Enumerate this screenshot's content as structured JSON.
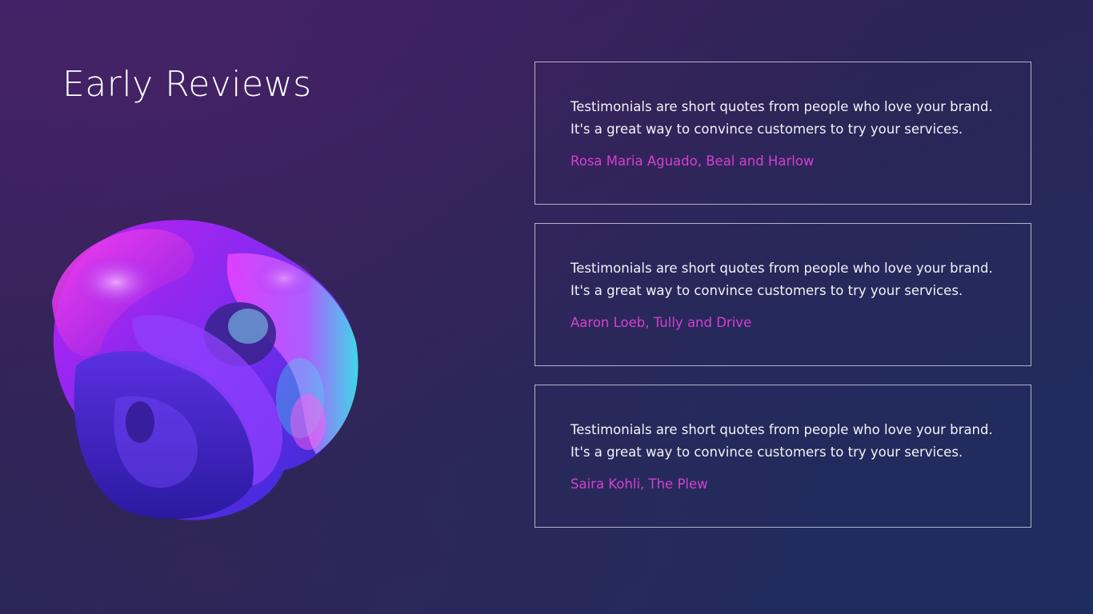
{
  "slide": {
    "title": "Early Reviews",
    "art_icon": "abstract-3d-knot-illustration",
    "colors": {
      "accent_author": "#d63fcf",
      "text_primary": "#ffffff",
      "card_border": "#e1e1f0"
    }
  },
  "testimonials": [
    {
      "quote": "Testimonials are short quotes from people who love your brand. It's a great way to convince customers to try your services.",
      "author": "Rosa Maria Aguado, Beal and Harlow"
    },
    {
      "quote": "Testimonials are short quotes from people who love your brand. It's a great way to convince customers to try your services.",
      "author": "Aaron Loeb, Tully and Drive"
    },
    {
      "quote": "Testimonials are short quotes from people who love your brand. It's a great way to convince customers to try your services.",
      "author": "Saira Kohli, The Plew"
    }
  ]
}
